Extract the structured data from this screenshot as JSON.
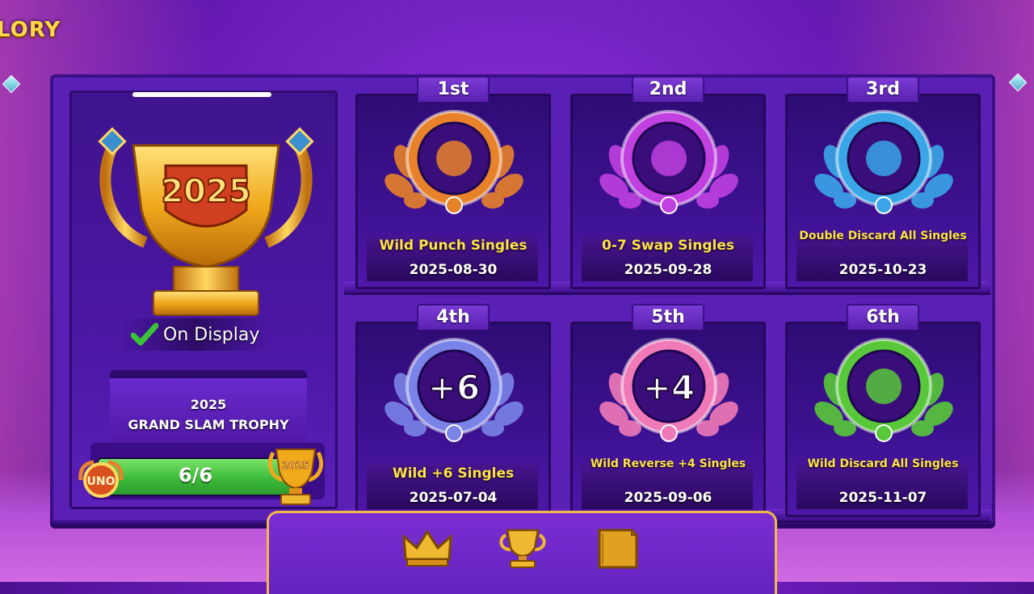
{
  "screen": {
    "title": "LORY"
  },
  "featured": {
    "status_label": "On Display",
    "trophy_year": "2025",
    "trophy_name_line1": "2025",
    "trophy_name_line2": "GRAND SLAM TROPHY",
    "badge_logo": "UNO",
    "mini_trophy_year": "2025",
    "progress": {
      "text": "6/6",
      "fraction": 1.0
    }
  },
  "badges": [
    {
      "rank": "1st",
      "title": "Wild Punch Singles",
      "date": "2025-08-30",
      "icon": "boxing-glove-icon",
      "color": "#e8822a"
    },
    {
      "rank": "2nd",
      "title": "0-7 Swap Singles",
      "date": "2025-09-28",
      "icon": "magic-hat-icon",
      "color": "#c040e0"
    },
    {
      "rank": "3rd",
      "title": "Double Discard All Singles",
      "date": "2025-10-23",
      "icon": "cards-ribbon-icon",
      "color": "#3aa6e8"
    },
    {
      "rank": "4th",
      "title": "Wild +6 Singles",
      "date": "2025-07-04",
      "icon": "plus-six-icon",
      "badge_text": "+6",
      "color": "#7a84e8"
    },
    {
      "rank": "5th",
      "title": "Wild Reverse +4 Singles",
      "date": "2025-09-06",
      "icon": "plus-four-icon",
      "badge_text": "+4",
      "color": "#f07ab8"
    },
    {
      "rank": "6th",
      "title": "Wild Discard All Singles",
      "date": "2025-11-07",
      "icon": "rocket-cards-icon",
      "color": "#58c83a"
    }
  ],
  "nav": [
    {
      "icon": "crown-icon"
    },
    {
      "icon": "trophy-icon",
      "active": true
    },
    {
      "icon": "book-icon"
    }
  ]
}
